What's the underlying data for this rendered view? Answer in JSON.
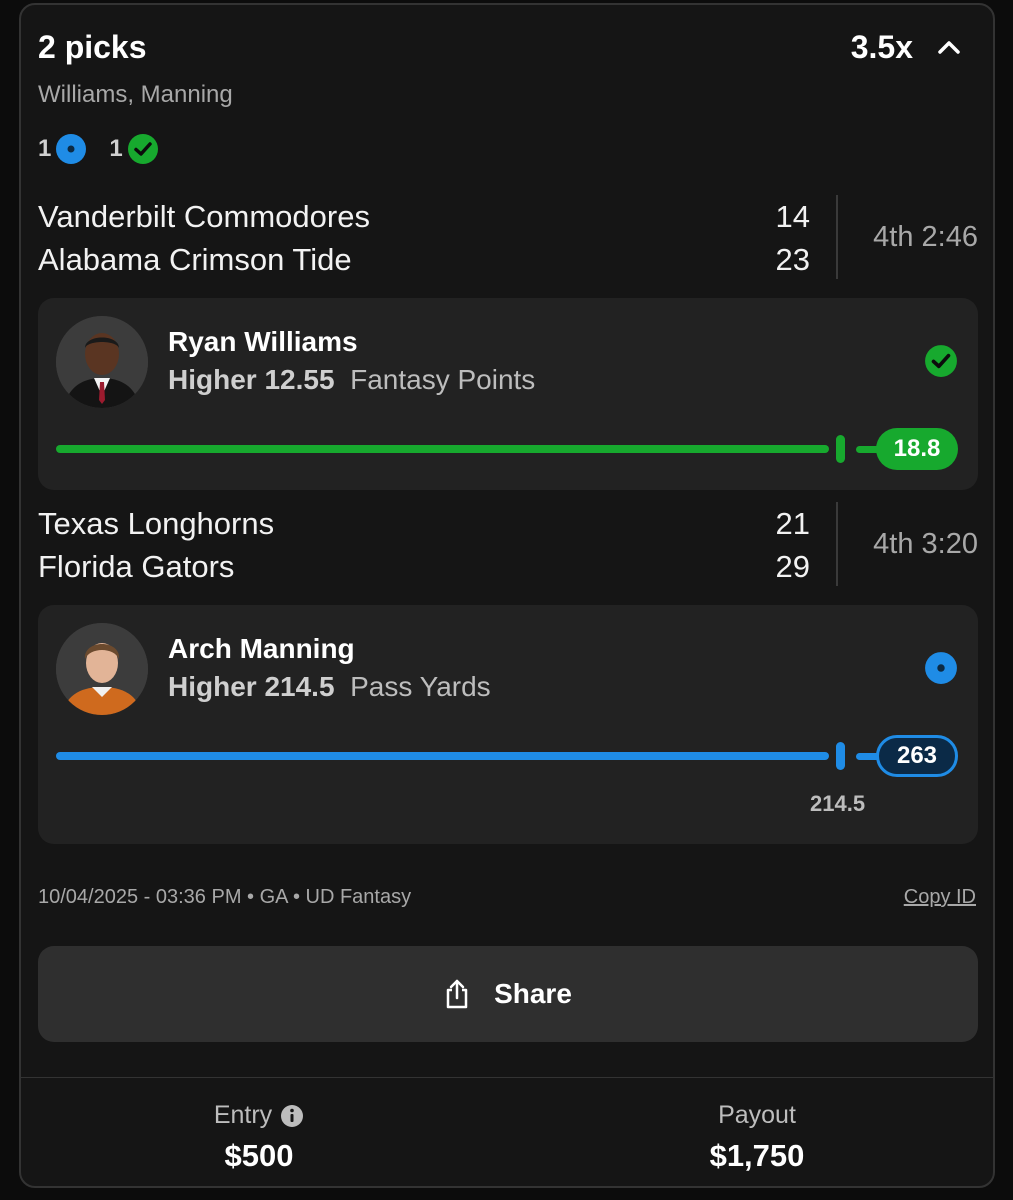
{
  "header": {
    "title": "2 picks",
    "multiplier": "3.5x",
    "players_subtitle": "Williams, Manning"
  },
  "summary": {
    "live_count": "1",
    "won_count": "1"
  },
  "games": [
    {
      "teams": [
        "Vanderbilt Commodores",
        "Alabama Crimson Tide"
      ],
      "scores": [
        "14",
        "23"
      ],
      "clock": "4th 2:46"
    },
    {
      "teams": [
        "Texas Longhorns",
        "Florida Gators"
      ],
      "scores": [
        "21",
        "29"
      ],
      "clock": "4th 3:20"
    }
  ],
  "picks": [
    {
      "player": "Ryan Williams",
      "direction_line": "Higher 12.55",
      "stat": "Fantasy Points",
      "current_value": "18.8",
      "threshold_label": "",
      "status": "won",
      "color": "#17a92e"
    },
    {
      "player": "Arch Manning",
      "direction_line": "Higher 214.5",
      "stat": "Pass Yards",
      "current_value": "263",
      "threshold_label": "214.5",
      "status": "live",
      "color": "#1f8ce6"
    }
  ],
  "meta": {
    "details": "10/04/2025 - 03:36 PM • GA • UD Fantasy",
    "copy_id": "Copy ID"
  },
  "share": {
    "label": "Share"
  },
  "footer": {
    "entry_label": "Entry",
    "entry_value": "$500",
    "payout_label": "Payout",
    "payout_value": "$1,750"
  },
  "colors": {
    "won": "#17a92e",
    "live": "#1f8ce6",
    "background": "#151515",
    "card": "#222222"
  }
}
